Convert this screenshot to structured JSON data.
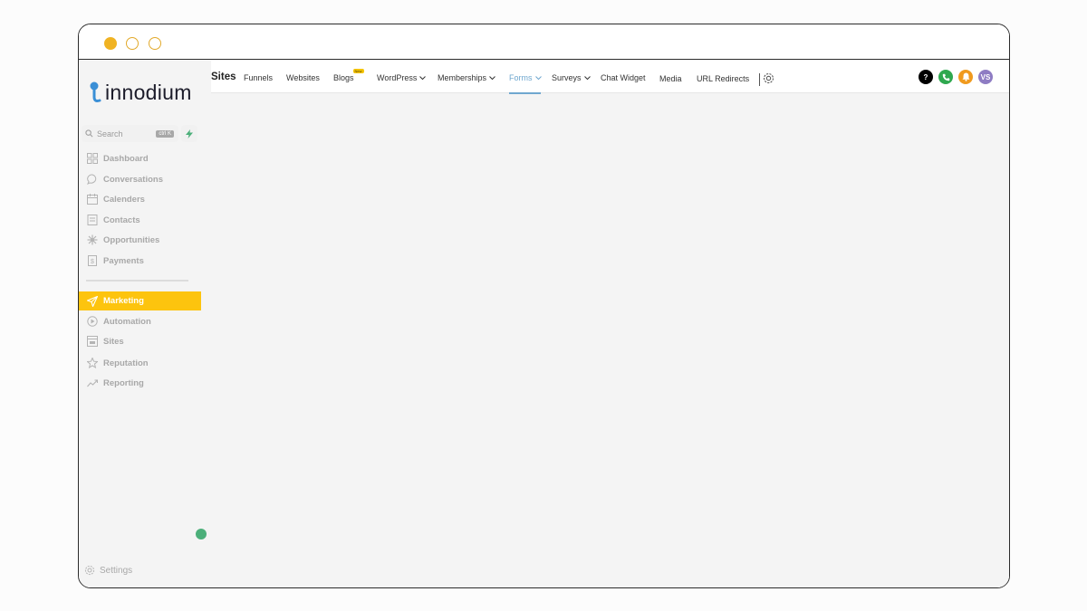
{
  "brand": {
    "name": "innodium",
    "accent": "#fdc40e"
  },
  "search": {
    "placeholder": "Search",
    "shortcut": "ctrl K",
    "action_icon": "bolt-icon"
  },
  "sidebar": {
    "items": [
      {
        "label": "Dashboard",
        "icon": "dashboard-icon"
      },
      {
        "label": "Conversations",
        "icon": "chat-icon"
      },
      {
        "label": "Calenders",
        "icon": "calendar-icon"
      },
      {
        "label": "Contacts",
        "icon": "contacts-icon"
      },
      {
        "label": "Opportunities",
        "icon": "opportunities-icon"
      },
      {
        "label": "Payments",
        "icon": "payments-icon"
      }
    ],
    "items2": [
      {
        "label": "Marketing",
        "icon": "send-icon",
        "active": true
      },
      {
        "label": "Automation",
        "icon": "automation-icon"
      },
      {
        "label": "Sites",
        "icon": "sites-icon"
      },
      {
        "label": "Reputation",
        "icon": "star-icon"
      },
      {
        "label": "Reporting",
        "icon": "trend-icon"
      }
    ],
    "settings_label": "Settings"
  },
  "topnav": {
    "title": "Sites",
    "items": [
      "Funnels",
      "Websites",
      "Blogs",
      "WordPress",
      "Memberships",
      "Forms",
      "Surveys",
      "Chat Widget",
      "Media",
      "URL Redirects"
    ],
    "active": "Forms",
    "blogs_badge": "New",
    "right_buttons": [
      {
        "icon": "help-icon",
        "text": "?",
        "color": "#000000"
      },
      {
        "icon": "phone-icon",
        "text": "",
        "color": "#2fa84f"
      },
      {
        "icon": "bell-icon",
        "text": "",
        "color": "#f09a1e"
      },
      {
        "icon": "avatar",
        "text": "VS",
        "color": "#8e7cc3"
      }
    ]
  }
}
